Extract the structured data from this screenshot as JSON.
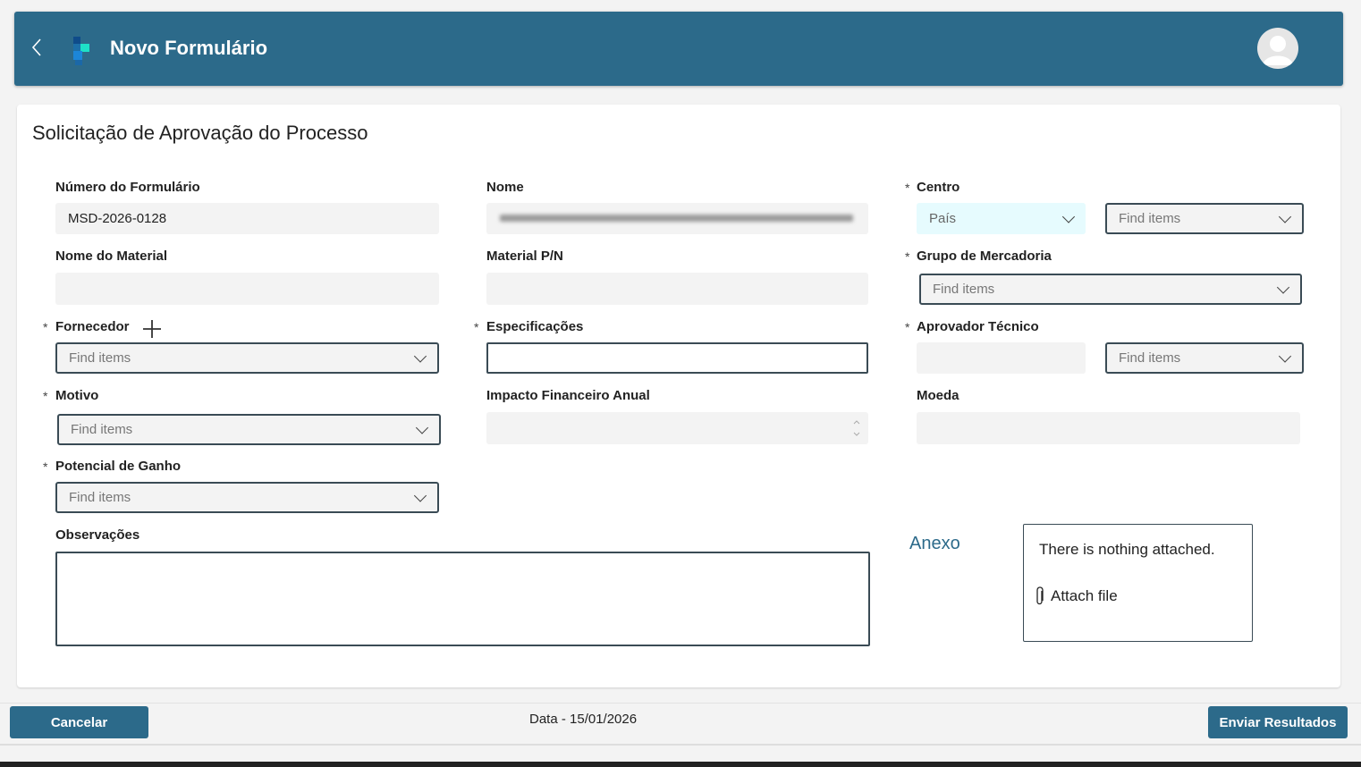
{
  "header": {
    "title": "Novo Formulário"
  },
  "form": {
    "title": "Solicitação de Aprovação do Processo",
    "numero_label": "Número do Formulário",
    "numero_value": "MSD-2026-0128",
    "nome_label": "Nome",
    "centro_label": "Centro",
    "centro_pais": "País",
    "centro_find": "Find items",
    "nome_material_label": "Nome do Material",
    "material_pn_label": "Material P/N",
    "grupo_label": "Grupo de Mercadoria",
    "grupo_find": "Find items",
    "fornecedor_label": "Fornecedor",
    "fornecedor_find": "Find items",
    "especificacoes_label": "Especificações",
    "aprovador_label": "Aprovador Técnico",
    "aprovador_find": "Find items",
    "motivo_label": "Motivo",
    "motivo_find": "Find items",
    "impacto_label": "Impacto Financeiro Anual",
    "moeda_label": "Moeda",
    "potencial_label": "Potencial de Ganho",
    "potencial_find": "Find items",
    "observacoes_label": "Observações",
    "anexo_label": "Anexo",
    "anexo_empty": "There is nothing attached.",
    "attach_label": "Attach file",
    "required_mark": "*"
  },
  "footer": {
    "cancel": "Cancelar",
    "date": "Data - 15/01/2026",
    "submit": "Enviar Resultados"
  }
}
